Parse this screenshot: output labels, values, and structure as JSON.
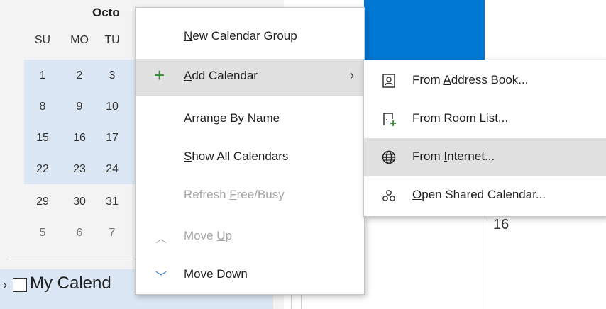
{
  "calendar": {
    "month": "Octo",
    "weekdays": [
      "SU",
      "MO",
      "TU"
    ],
    "weeks": [
      [
        "1",
        "2",
        "3"
      ],
      [
        "8",
        "9",
        "10"
      ],
      [
        "15",
        "16",
        "17"
      ],
      [
        "22",
        "23",
        "24"
      ],
      [
        "29",
        "30",
        "31"
      ],
      [
        "5",
        "6",
        "7"
      ]
    ],
    "my_calendars_label": "My Calend",
    "day_number": "16"
  },
  "menu": {
    "items": [
      {
        "pre": "",
        "u": "N",
        "post": "ew Calendar Group"
      },
      {
        "pre": "",
        "u": "A",
        "post": "dd Calendar",
        "arrow": "›"
      },
      {
        "pre": "",
        "u": "A",
        "post": "rrange By Name"
      },
      {
        "pre": "",
        "u": "S",
        "post": "how All Calendars"
      },
      {
        "pre": "Refresh ",
        "u": "F",
        "post": "ree/Busy"
      },
      {
        "pre": "Move ",
        "u": "U",
        "post": "p"
      },
      {
        "pre": "Move D",
        "u": "o",
        "post": "wn"
      }
    ]
  },
  "submenu": {
    "items": [
      {
        "pre": "From ",
        "u": "A",
        "post": "ddress Book..."
      },
      {
        "pre": "From ",
        "u": "R",
        "post": "oom List..."
      },
      {
        "pre": "From ",
        "u": "I",
        "post": "nternet..."
      },
      {
        "pre": "",
        "u": "O",
        "post": "pen Shared Calendar..."
      }
    ]
  },
  "icons": {
    "add": "plus-icon",
    "address_book": "address-book-icon",
    "room_list": "room-list-icon",
    "internet": "globe-icon",
    "shared": "shared-calendar-icon",
    "move_up": "chevron-up-icon",
    "move_down": "chevron-down-icon"
  },
  "colors": {
    "accent": "#0078d4",
    "selection": "#dbe7f4",
    "hover": "#e0e0e0",
    "plus": "#2e8b2e"
  }
}
